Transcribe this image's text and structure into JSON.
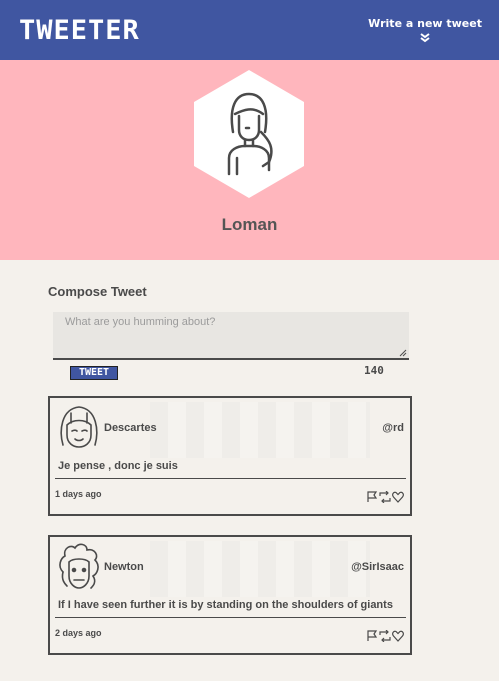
{
  "nav": {
    "brand": "TWEETER",
    "compose_label": "Write a new tweet",
    "compose_icon": "double-chevron-down-icon"
  },
  "profile": {
    "name": "Loman",
    "avatar_icon": "woman-avatar-icon"
  },
  "compose": {
    "title": "Compose Tweet",
    "placeholder": "What are you humming about?",
    "button_label": "TWEET",
    "counter": "140"
  },
  "tweets": [
    {
      "name": "Descartes",
      "handle": "@rd",
      "content": "Je pense , donc je suis",
      "time": "1 days ago",
      "avatar_icon": "descartes-avatar-icon"
    },
    {
      "name": "Newton",
      "handle": "@SirIsaac",
      "content": "If I have seen further it is by standing on the shoulders of giants",
      "time": "2 days ago",
      "avatar_icon": "newton-avatar-icon"
    }
  ],
  "colors": {
    "nav": "#4056a1",
    "hero": "#ffb6bd",
    "background": "#f4f1ec",
    "text": "#4a4a4a"
  }
}
